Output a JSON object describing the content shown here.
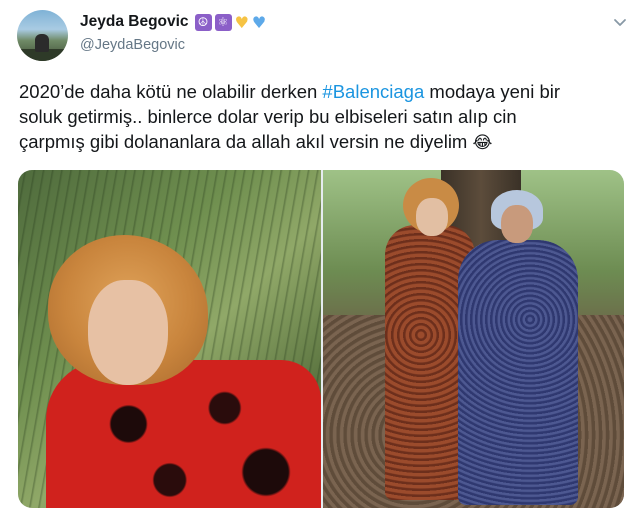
{
  "tweet": {
    "display_name": "Jeyda Begovic",
    "handle": "@JeydaBegovic",
    "badges": [
      "peace-emoji",
      "atom-emoji",
      "yellow-heart-emoji",
      "blue-heart-emoji"
    ],
    "text_line1_pre": "2020’de daha kötü ne olabilir derken ",
    "hashtag": "#Balenciaga",
    "text_line1_post": " modaya yeni bir",
    "text_line2": "soluk getirmiş.. binlerce dolar verip bu elbiseleri satın alıp cin",
    "text_line3": "çarpmış gibi dolananlara da allah akıl versin ne diyelim",
    "text_emoji": "😂",
    "media": [
      {
        "name": "photo-red-shirt"
      },
      {
        "name": "photo-two-dresses"
      }
    ]
  },
  "colors": {
    "link": "#1b95e0",
    "secondary_text": "#657786",
    "primary_text": "#14171a"
  }
}
